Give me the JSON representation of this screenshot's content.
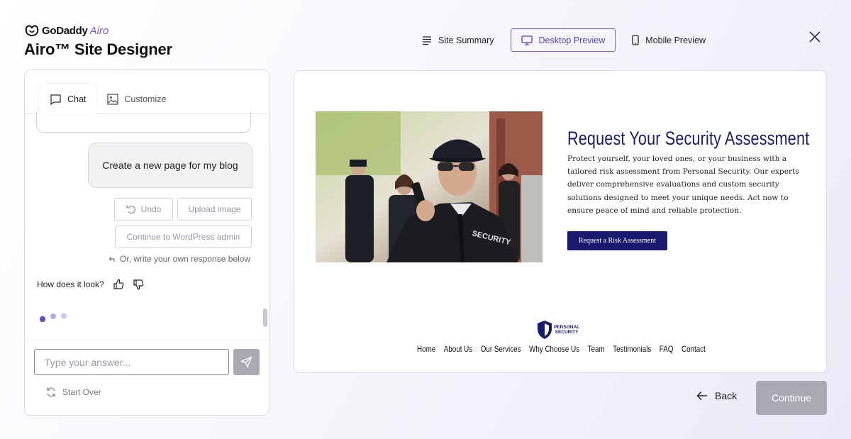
{
  "brand": {
    "logo_godaddy": "GoDaddy",
    "logo_airo": "Airo",
    "title": "Airo™ Site Designer"
  },
  "topnav": {
    "site_summary": "Site Summary",
    "desktop_preview": "Desktop Preview",
    "mobile_preview": "Mobile Preview"
  },
  "chat": {
    "tabs": [
      "Chat",
      "Customize"
    ],
    "user_message": "Create a new page for my blog",
    "suggestions": {
      "undo": "Undo",
      "upload_image": "Upload image",
      "continue_wordpress": "Continue to WordPress admin"
    },
    "hint": "Or, write your own response below",
    "feedback_question": "How does it look?",
    "input_placeholder": "Type your answer...",
    "start_over": "Start Over"
  },
  "preview": {
    "hero_title": "Request Your Security Assessment",
    "hero_description": "Protect yourself, your loved ones, or your business with a tailored risk assessment from Personal Security. Our experts deliver comprehensive evaluations and custom security solutions designed to meet your unique needs. Act now to ensure peace of mind and reliable protection.",
    "hero_cta": "Request a Risk Assessment",
    "jacket_text": "SECURITY",
    "logo_line1": "PERSONAL",
    "logo_line2": "SECURITY",
    "nav": [
      "Home",
      "About Us",
      "Our Services",
      "Why Choose Us",
      "Team",
      "Testimonials",
      "FAQ",
      "Contact"
    ]
  },
  "footer": {
    "back": "Back",
    "continue": "Continue"
  },
  "colors": {
    "accent": "#7b5cd6",
    "site_navy": "#1a1a6e",
    "disabled": "#aaa8b2"
  }
}
